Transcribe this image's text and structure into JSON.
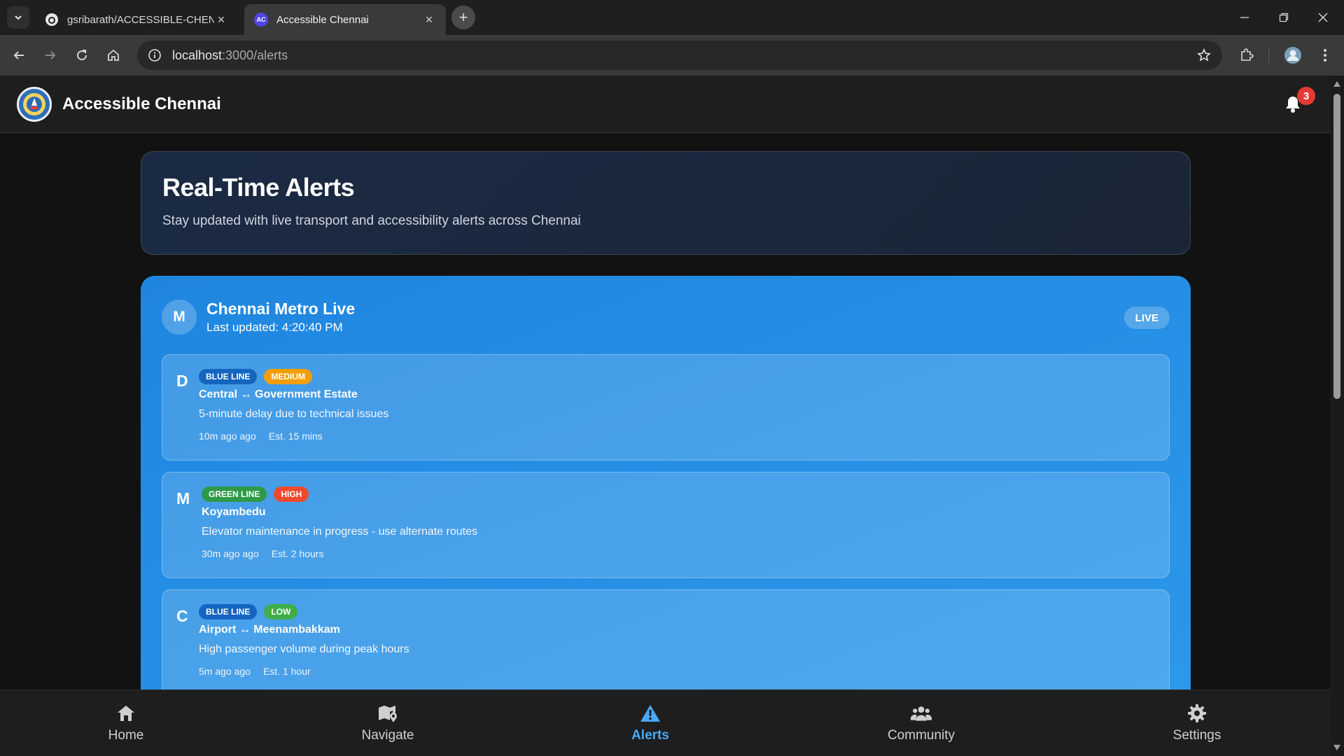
{
  "browser": {
    "tabs": [
      {
        "title": "gsribarath/ACCESSIBLE-CHENNAI",
        "active": false,
        "favicon": "github-icon"
      },
      {
        "title": "Accessible Chennai",
        "active": true,
        "favicon": "AC",
        "favicon_color": "#4f46e5"
      }
    ],
    "url_host": "localhost",
    "url_path": ":3000/alerts"
  },
  "app": {
    "brand": "Accessible Chennai",
    "notification_count": "3"
  },
  "hero": {
    "title": "Real-Time Alerts",
    "subtitle": "Stay updated with live transport and accessibility alerts across Chennai"
  },
  "metro": {
    "avatar": "M",
    "title": "Chennai Metro Live",
    "updated": "Last updated: 4:20:40 PM",
    "live_label": "LIVE",
    "alerts": [
      {
        "letter": "D",
        "line": "BLUE LINE",
        "line_color": "#1565c0",
        "severity": "MEDIUM",
        "severity_color": "#f59e0b",
        "route": "Central ↔ Government Estate",
        "description": "5-minute delay due to technical issues",
        "time": "10m ago ago",
        "estimate": "Est. 15 mins"
      },
      {
        "letter": "M",
        "line": "GREEN LINE",
        "line_color": "#2e9a47",
        "severity": "HIGH",
        "severity_color": "#ef4a2f",
        "route": "Koyambedu",
        "description": "Elevator maintenance in progress - use alternate routes",
        "time": "30m ago ago",
        "estimate": "Est. 2 hours"
      },
      {
        "letter": "C",
        "line": "BLUE LINE",
        "line_color": "#1565c0",
        "severity": "LOW",
        "severity_color": "#3fae4a",
        "route": "Airport ↔ Meenambakkam",
        "description": "High passenger volume during peak hours",
        "time": "5m ago ago",
        "estimate": "Est. 1 hour"
      }
    ]
  },
  "nav": {
    "items": [
      {
        "label": "Home",
        "icon": "home-icon",
        "active": false
      },
      {
        "label": "Navigate",
        "icon": "map-icon",
        "active": false
      },
      {
        "label": "Alerts",
        "icon": "warning-icon",
        "active": true
      },
      {
        "label": "Community",
        "icon": "users-icon",
        "active": false
      },
      {
        "label": "Settings",
        "icon": "gear-icon",
        "active": false
      }
    ]
  },
  "colors": {
    "accent": "#4aa8f5",
    "metro_card": "#2390e6",
    "hero_bg": "#1b2b44"
  }
}
